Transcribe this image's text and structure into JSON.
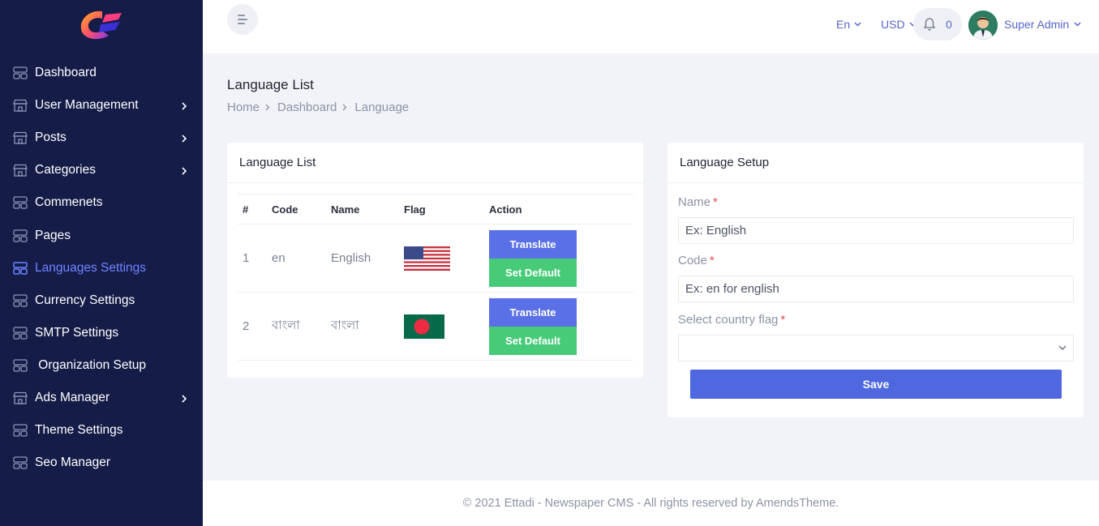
{
  "header": {
    "language": "En",
    "currency": "USD",
    "notification_count": "0",
    "user_name": "Super Admin"
  },
  "sidebar": {
    "items": [
      {
        "label": "Dashboard",
        "icon": "dashboard-icon",
        "has_submenu": false,
        "active": false
      },
      {
        "label": "User Management",
        "icon": "store-icon",
        "has_submenu": true,
        "active": false
      },
      {
        "label": "Posts",
        "icon": "store-icon",
        "has_submenu": true,
        "active": false
      },
      {
        "label": "Categories",
        "icon": "store-icon",
        "has_submenu": true,
        "active": false
      },
      {
        "label": "Commenets",
        "icon": "dashboard-icon",
        "has_submenu": false,
        "active": false
      },
      {
        "label": "Pages",
        "icon": "dashboard-icon",
        "has_submenu": false,
        "active": false
      },
      {
        "label": "Languages Settings",
        "icon": "dashboard-icon",
        "has_submenu": false,
        "active": true
      },
      {
        "label": "Currency Settings",
        "icon": "dashboard-icon",
        "has_submenu": false,
        "active": false
      },
      {
        "label": "SMTP Settings",
        "icon": "dashboard-icon",
        "has_submenu": false,
        "active": false
      },
      {
        "label": " Organization Setup",
        "icon": "dashboard-icon",
        "has_submenu": false,
        "active": false
      },
      {
        "label": "Ads Manager",
        "icon": "store-icon",
        "has_submenu": true,
        "active": false
      },
      {
        "label": "Theme Settings",
        "icon": "dashboard-icon",
        "has_submenu": false,
        "active": false
      },
      {
        "label": "Seo Manager",
        "icon": "dashboard-icon",
        "has_submenu": false,
        "active": false
      }
    ]
  },
  "page": {
    "title": "Language List",
    "breadcrumb": [
      "Home",
      "Dashboard",
      "Language"
    ]
  },
  "language_list": {
    "title": "Language List",
    "columns": [
      "#",
      "Code",
      "Name",
      "Flag",
      "Action"
    ],
    "rows": [
      {
        "num": "1",
        "code": "en",
        "name": "English",
        "flag": "us-flag-icon",
        "translate_label": "Translate",
        "default_label": "Set Default"
      },
      {
        "num": "2",
        "code": "বাংলা",
        "name": "বাংলা",
        "flag": "bd-flag-icon",
        "translate_label": "Translate",
        "default_label": "Set Default"
      }
    ]
  },
  "language_setup": {
    "title": "Language Setup",
    "name_label": "Name",
    "name_placeholder": "Ex: English",
    "code_label": "Code",
    "code_placeholder": "Ex: en for english",
    "flag_label": "Select country flag",
    "required_mark": "*",
    "save_label": "Save"
  },
  "footer": {
    "text": "© 2021 Ettadi - Newspaper CMS - All rights reserved by AmendsTheme."
  },
  "colors": {
    "sidebar_bg": "#151c48",
    "accent": "#5a70e6",
    "success": "#47cb79",
    "active_nav": "#6f84ff"
  }
}
